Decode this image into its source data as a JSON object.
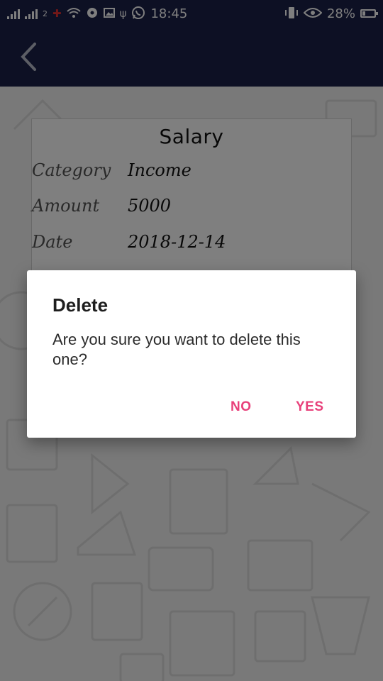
{
  "status_bar": {
    "time": "18:45",
    "battery_percent": "28%",
    "battery_level": 0.28,
    "sim2_label": "2",
    "icons": [
      "signal-icon",
      "signal-icon",
      "sim-icon",
      "wifi-icon",
      "circle-icon",
      "image-icon",
      "usb-icon",
      "whatsapp-icon",
      "vibrate-icon",
      "eye-icon",
      "battery-icon"
    ]
  },
  "app_bar": {
    "back_icon": "back-arrow-icon"
  },
  "record": {
    "title": "Salary",
    "fields": [
      {
        "label": "Category",
        "value": "Income"
      },
      {
        "label": "Amount",
        "value": "5000"
      },
      {
        "label": "Date",
        "value": "2018-12-14"
      }
    ]
  },
  "dialog": {
    "title": "Delete",
    "message": "Are you sure you want to delete this one?",
    "no_label": "NO",
    "yes_label": "YES",
    "accent_color": "#e8407a"
  },
  "colors": {
    "app_bar": "#1a2048",
    "background": "#f2f2f2"
  }
}
